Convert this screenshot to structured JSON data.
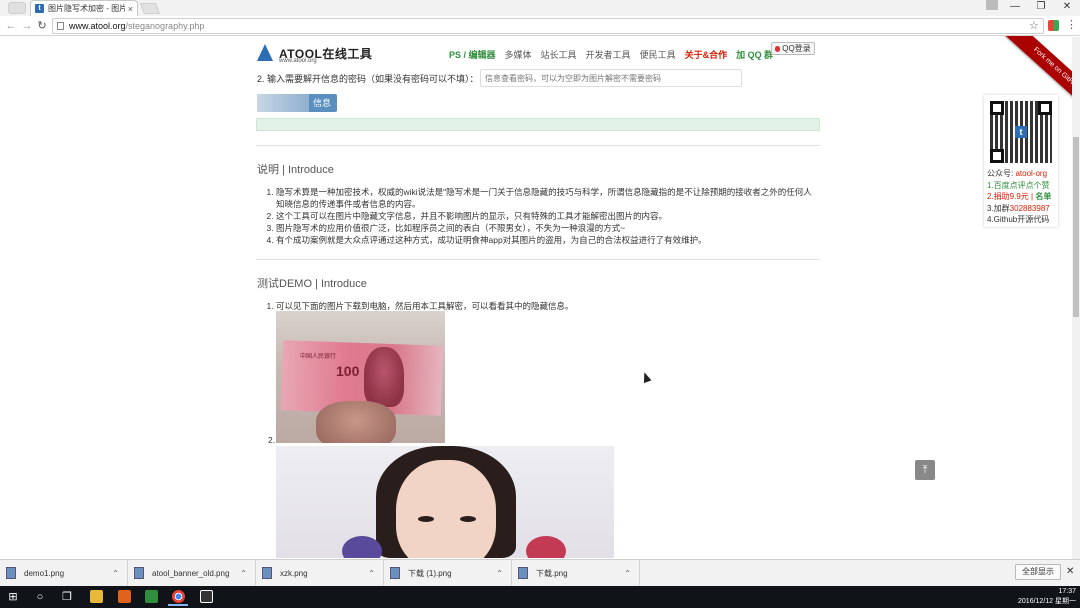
{
  "browser": {
    "tab_title": "图片隐写术加密 - 图片隐",
    "tab_close": "×",
    "url_host": "www.atool.org",
    "url_path": "/steganography.php",
    "nav_back": "←",
    "nav_forward": "→",
    "nav_reload": "↻",
    "star": "☆",
    "menu": "⋮",
    "win_minimize": "—",
    "win_restore": "❐",
    "win_close": "✕"
  },
  "site": {
    "logo_text": "ATOOL在线工具",
    "logo_url": "www.atool.org",
    "nav": [
      "PS / 编辑器",
      "多媒体",
      "站长工具",
      "开发者工具",
      "便民工具",
      "关于&合作",
      "加 QQ 群"
    ],
    "qq_login": "QQ登录",
    "ribbon": "Fork me on GitHub"
  },
  "form": {
    "password_label": "2. 输入需要解开信息的密码（如果没有密码可以不填）：",
    "password_placeholder": "信息查看密码，可以为空即为图片解密不需要密码",
    "decode_button": "信息"
  },
  "intro": {
    "title": "说明 | Introduce",
    "items": [
      "隐写术算是一种加密技术，权威的wiki说法是\"隐写术是一门关于信息隐藏的技巧与科学，所谓信息隐藏指的是不让除预期的接收者之外的任何人知晓信息的传递事件或者信息的内容。",
      "这个工具可以在图片中隐藏文字信息，并且不影响图片的显示，只有特殊的工具才能解密出图片的内容。",
      "图片隐写术的应用价值很广泛，比如程序员之间的表白（不限男女），不失为一种浪漫的方式~",
      "有个成功案例就是大众点评通过这种方式，成功证明食神app对其图片的盗用，为自己的合法权益进行了有效维护。"
    ]
  },
  "demo": {
    "title": "测试DEMO | Introduce",
    "items": [
      "可以见下面的图片下载到电脑，然后用本工具解密，可以看看其中的隐藏信息。"
    ],
    "second_number": "2.",
    "banknote_text": "100",
    "banknote_cn": "中国人民银行"
  },
  "side": {
    "qr_center": "t",
    "line0_prefix": "公众号: ",
    "line0_handle": "atool-org",
    "line1": "1.百度点评点个赞",
    "line2_prefix": "2.捐助9.9元 | ",
    "line2_suffix": "名单",
    "line3_prefix": "3.加群",
    "line3_group": "302883987",
    "line4": "4.Github开源代码"
  },
  "back_to_top": "⤒",
  "downloads": {
    "items": [
      {
        "name": "demo1.png"
      },
      {
        "name": "atool_banner_old.png"
      },
      {
        "name": "xzk.png"
      },
      {
        "name": "下载 (1).png"
      },
      {
        "name": "下载.png"
      }
    ],
    "caret": "⌃",
    "show_all": "全部显示",
    "close": "✕"
  },
  "taskbar": {
    "start": "⊞",
    "search": "○",
    "taskview": "❐",
    "time": "17:37",
    "date": "2016/12/12 星期一"
  },
  "colors": {
    "accent_blue": "#2d6db5",
    "accent_green": "#2f8f3e",
    "accent_red": "#d81e06",
    "ribbon": "#aa0000"
  }
}
